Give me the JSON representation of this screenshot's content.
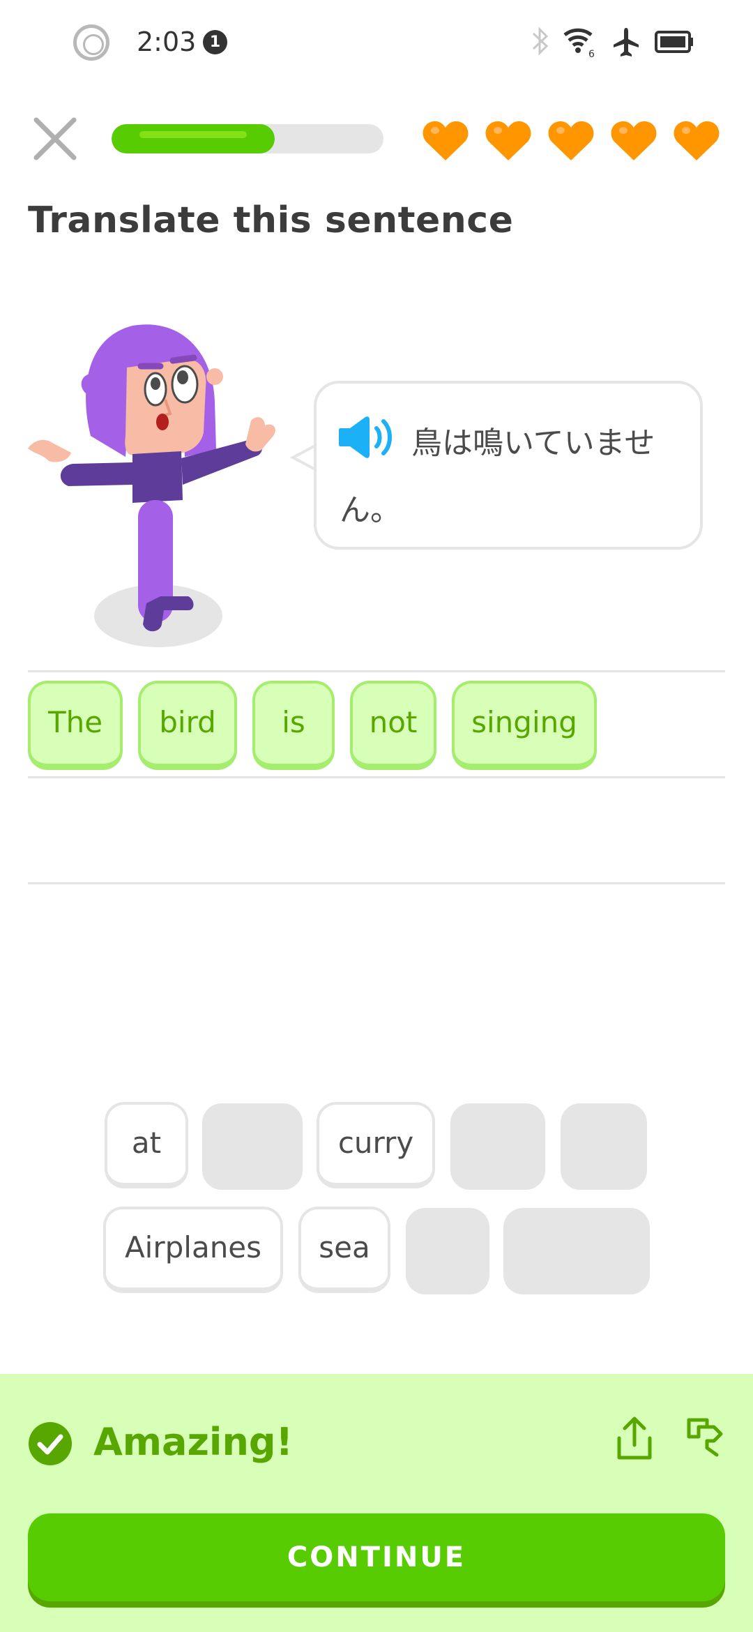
{
  "status_bar": {
    "time": "2:03",
    "notification_count": "1",
    "icons": [
      "record-icon",
      "bluetooth-icon",
      "wifi-icon",
      "airplane-icon",
      "battery-icon"
    ],
    "wifi_label": "6"
  },
  "header": {
    "close_icon": "close-icon",
    "progress_fraction": 0.6,
    "hearts": 5,
    "heart_color": "#FF9600"
  },
  "prompt": {
    "title": "Translate this sentence",
    "speech_text": "鳥は鳴いていません。",
    "speaker_icon": "speaker-icon"
  },
  "answer": {
    "words": [
      "The",
      "bird",
      "is",
      "not",
      "singing"
    ]
  },
  "word_bank": {
    "row1": [
      "at",
      "",
      "curry",
      "",
      ""
    ],
    "row2": [
      "Airplanes",
      "sea",
      "",
      ""
    ]
  },
  "feedback": {
    "title": "Amazing!",
    "continue_label": "CONTINUE",
    "colors": {
      "accent": "#58CC02",
      "accent_dark": "#58A700",
      "panel": "#D7FFB8"
    }
  }
}
